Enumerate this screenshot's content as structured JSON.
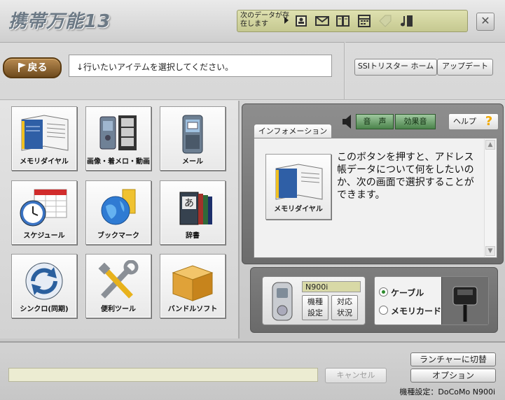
{
  "app": {
    "logo_text": "携帯万能13"
  },
  "notification": {
    "text": "次のデータが存在します",
    "icons": [
      "address-book-icon",
      "mail-icon",
      "bookmark-book-icon",
      "calendar-icon",
      "tag-icon",
      "music-icon"
    ]
  },
  "nav": {
    "back_label": "戻る",
    "instruction": "↓行いたいアイテムを選択してください。",
    "ssi_home_label": "SSIトリスター ホーム",
    "update_label": "アップデート"
  },
  "tiles": [
    {
      "label": "メモリダイヤル",
      "icon": "address-book-icon"
    },
    {
      "label": "画像・着メロ・動画",
      "icon": "media-phone-icon"
    },
    {
      "label": "メール",
      "icon": "mobile-phone-icon"
    },
    {
      "label": "スケジュール",
      "icon": "clock-calendar-icon"
    },
    {
      "label": "ブックマーク",
      "icon": "globe-bookmark-icon"
    },
    {
      "label": "辞書",
      "icon": "dictionary-icon"
    },
    {
      "label": "シンクロ(同期)",
      "icon": "sync-icon"
    },
    {
      "label": "便利ツール",
      "icon": "tools-icon"
    },
    {
      "label": "バンドルソフト",
      "icon": "box-icon"
    }
  ],
  "info": {
    "voice_label": "音　声",
    "effect_label": "効果音",
    "help_label": "ヘルプ",
    "tab_label": "インフォメーション",
    "tile_label": "メモリダイヤル",
    "description": "このボタンを押すと、アドレス帳データについて何をしたいのか、次の画面で選択することができます。"
  },
  "device": {
    "model": "N900i",
    "model_settings_label": "機種\n設定",
    "support_status_label": "対応\n状況",
    "connection_options": [
      {
        "label": "ケーブル",
        "selected": true
      },
      {
        "label": "メモリカード",
        "selected": false
      }
    ]
  },
  "bottom": {
    "cancel_label": "キャンセル",
    "launcher_label": "ランチャーに切替",
    "options_label": "オプション",
    "model_status": "機種設定：DoCoMo N900i"
  }
}
